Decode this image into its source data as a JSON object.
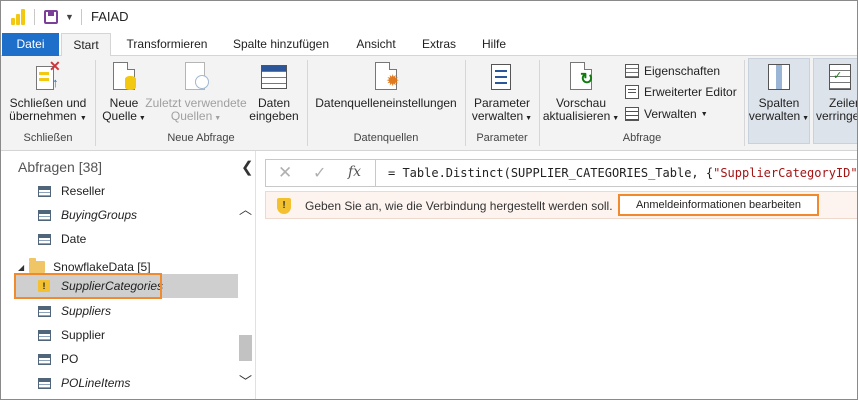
{
  "window": {
    "title": "FAIAD"
  },
  "tabs": [
    {
      "label": "Datei"
    },
    {
      "label": "Start"
    },
    {
      "label": "Transformieren"
    },
    {
      "label": "Spalte hinzufügen"
    },
    {
      "label": "Ansicht"
    },
    {
      "label": "Extras"
    },
    {
      "label": "Hilfe"
    }
  ],
  "ribbon": {
    "close_apply_line1": "Schließen und",
    "close_apply_line2": "übernehmen",
    "group_close": "Schließen",
    "new_source_line1": "Neue",
    "new_source_line2": "Quelle",
    "recent_sources_line1": "Zuletzt verwendete",
    "recent_sources_line2": "Quellen",
    "enter_data_line1": "Daten",
    "enter_data_line2": "eingeben",
    "group_new_query": "Neue Abfrage",
    "datasource_settings": "Datenquelleneinstellungen",
    "group_datasources": "Datenquellen",
    "manage_params_line1": "Parameter",
    "manage_params_line2": "verwalten",
    "group_params": "Parameter",
    "refresh_preview_line1": "Vorschau",
    "refresh_preview_line2": "aktualisieren",
    "properties": "Eigenschaften",
    "advanced_editor": "Erweiterter Editor",
    "manage": "Verwalten",
    "group_query": "Abfrage",
    "manage_columns_line1": "Spalten",
    "manage_columns_line2": "verwalten",
    "reduce_rows_line1": "Zeilen",
    "reduce_rows_line2": "verringern"
  },
  "queries_panel": {
    "header": "Abfragen [38]",
    "items": [
      {
        "label": "Reseller"
      },
      {
        "label": "BuyingGroups"
      },
      {
        "label": "Date"
      }
    ],
    "folder": {
      "label": "SnowflakeData [5]"
    },
    "folder_items": [
      {
        "label": "SupplierCategories"
      },
      {
        "label": "Suppliers"
      },
      {
        "label": "Supplier"
      },
      {
        "label": "PO"
      },
      {
        "label": "POLineItems"
      }
    ]
  },
  "formula_bar": {
    "fx": "fx",
    "expr_prefix": "= Table.Distinct(SUPPLIER_CATEGORIES_Table, {",
    "expr_string": "\"SupplierCategoryID\"",
    "expr_suffix": "})"
  },
  "warning": {
    "message": "Geben Sie an, wie die Verbindung hergestellt werden soll.",
    "button": "Anmeldeinformationen bearbeiten"
  }
}
